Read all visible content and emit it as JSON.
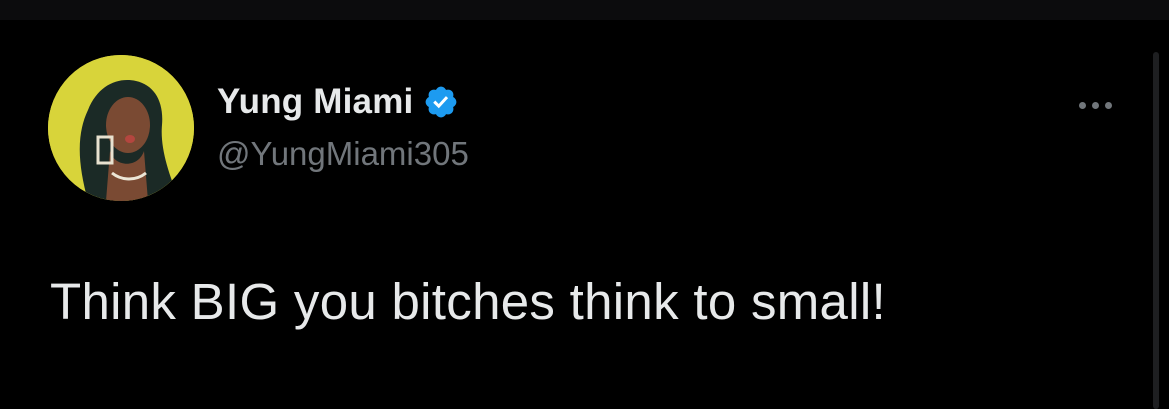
{
  "tweet": {
    "author": {
      "display_name": "Yung Miami",
      "handle": "@YungMiami305",
      "verified": true,
      "avatar_icon": "profile-photo"
    },
    "text": "Think BIG you bitches think to small!",
    "more_icon": "more-horizontal-icon"
  },
  "colors": {
    "background": "#000000",
    "primary_text": "#e7e9ea",
    "secondary_text": "#71767b",
    "verified_blue": "#1d9bf0",
    "avatar_bg": "#d8d43a"
  }
}
